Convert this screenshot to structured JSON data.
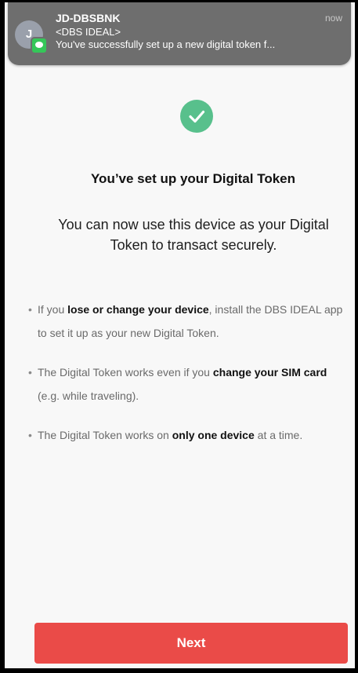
{
  "notification": {
    "avatar_initial": "J",
    "sender": "JD-DBSBNK",
    "subtitle": "<DBS IDEAL>",
    "message": "You've successfully set up a new digital token f...",
    "time": "now",
    "app_icon": "messages-icon"
  },
  "success_icon": "check-circle-icon",
  "colors": {
    "success": "#58c08c",
    "primary_button": "#ea4b48",
    "notification_bg": "#6e6e6e"
  },
  "main": {
    "title": "You’ve set up your Digital Token",
    "subtitle": "You can now use this device as your Digital Token to transact securely."
  },
  "bullets": [
    {
      "before": "If you ",
      "bold": "lose or change your device",
      "after": ", install the DBS IDEAL app to set it up as your new Digital Token."
    },
    {
      "before": "The Digital Token works even if you ",
      "bold": "change your SIM card",
      "after": " (e.g. while traveling)."
    },
    {
      "before": "The Digital Token works on ",
      "bold": "only one device",
      "after": " at a time."
    }
  ],
  "footer": {
    "next_label": "Next"
  }
}
